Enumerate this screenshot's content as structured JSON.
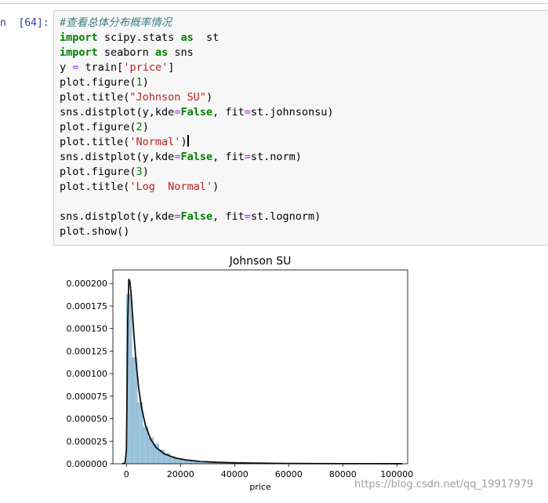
{
  "cell": {
    "prompt": "n  [64]:",
    "code_tokens": [
      [
        [
          "cm",
          "#查看总体分布概率情况"
        ]
      ],
      [
        [
          "kw",
          "import"
        ],
        [
          "t",
          " scipy.stats "
        ],
        [
          "kw",
          "as"
        ],
        [
          "t",
          "  st"
        ]
      ],
      [
        [
          "kw",
          "import"
        ],
        [
          "t",
          " seaborn "
        ],
        [
          "kw",
          "as"
        ],
        [
          "t",
          " sns"
        ]
      ],
      [
        [
          "t",
          "y "
        ],
        [
          "op",
          "="
        ],
        [
          "t",
          " train["
        ],
        [
          "str",
          "'price'"
        ],
        [
          "t",
          "]"
        ]
      ],
      [
        [
          "t",
          "plot.figure("
        ],
        [
          "num",
          "1"
        ],
        [
          "t",
          ")"
        ]
      ],
      [
        [
          "t",
          "plot.title("
        ],
        [
          "str",
          "\"Johnson SU\""
        ],
        [
          "t",
          ")"
        ]
      ],
      [
        [
          "t",
          "sns.distplot(y,kde"
        ],
        [
          "op",
          "="
        ],
        [
          "kw",
          "False"
        ],
        [
          "t",
          ", fit"
        ],
        [
          "op",
          "="
        ],
        [
          "t",
          "st.johnsonsu)"
        ]
      ],
      [
        [
          "t",
          "plot.figure("
        ],
        [
          "num",
          "2"
        ],
        [
          "t",
          ")"
        ]
      ],
      [
        [
          "t",
          "plot.title("
        ],
        [
          "str",
          "'Normal'"
        ],
        [
          "t",
          ")"
        ],
        [
          "cursor",
          ""
        ]
      ],
      [
        [
          "t",
          "sns.distplot(y,kde"
        ],
        [
          "op",
          "="
        ],
        [
          "kw",
          "False"
        ],
        [
          "t",
          ", fit"
        ],
        [
          "op",
          "="
        ],
        [
          "t",
          "st.norm)"
        ]
      ],
      [
        [
          "t",
          "plot.figure("
        ],
        [
          "num",
          "3"
        ],
        [
          "t",
          ")"
        ]
      ],
      [
        [
          "t",
          "plot.title("
        ],
        [
          "str",
          "'Log  Normal'"
        ],
        [
          "t",
          ")"
        ]
      ],
      [],
      [
        [
          "t",
          "sns.distplot(y,kde"
        ],
        [
          "op",
          "="
        ],
        [
          "kw",
          "False"
        ],
        [
          "t",
          ", fit"
        ],
        [
          "op",
          "="
        ],
        [
          "t",
          "st.lognorm)"
        ]
      ],
      [
        [
          "t",
          "plot.show()"
        ]
      ]
    ]
  },
  "chart_data": {
    "type": "bar",
    "title": "Johnson SU",
    "xlabel": "price",
    "ylabel": "",
    "xlim": [
      -5000,
      104000
    ],
    "ylim": [
      0,
      0.000215
    ],
    "grid": false,
    "legend": "none",
    "bin_width": 2000,
    "hist_color": "#9dc4dc",
    "hist_edge": "#6a9fc4",
    "fit_color": "#111111",
    "x_ticks": [
      0,
      20000,
      40000,
      60000,
      80000,
      100000
    ],
    "x_tick_labels": [
      "0",
      "20000",
      "40000",
      "60000",
      "80000",
      "100000"
    ],
    "y_ticks": [
      0,
      2.5e-05,
      5e-05,
      7.5e-05,
      0.0001,
      0.000125,
      0.00015,
      0.000175,
      0.0002
    ],
    "y_tick_labels": [
      "0.000000",
      "0.000025",
      "0.000050",
      "0.000075",
      "0.000100",
      "0.000125",
      "0.000150",
      "0.000175",
      "0.000200"
    ],
    "histogram": {
      "bin_starts": [
        0,
        2000,
        4000,
        6000,
        8000,
        10000,
        12000,
        14000,
        16000,
        18000,
        20000,
        22000,
        24000,
        26000,
        28000,
        30000,
        34000,
        40000,
        50000,
        60000,
        70000,
        80000,
        90000
      ],
      "bin_widths": [
        2000,
        2000,
        2000,
        2000,
        2000,
        2000,
        2000,
        2000,
        2000,
        2000,
        2000,
        2000,
        2000,
        2000,
        2000,
        4000,
        6000,
        10000,
        10000,
        10000,
        10000,
        10000,
        11000
      ],
      "values": [
        0.000188,
        0.000118,
        6.8e-05,
        4.1e-05,
        2.9e-05,
        2.2e-05,
        1.55e-05,
        1.15e-05,
        8e-06,
        6e-06,
        4.5e-06,
        3.5e-06,
        2.8e-06,
        2.2e-06,
        1.7e-06,
        1.3e-06,
        9e-07,
        6e-07,
        3e-07,
        2e-07,
        1e-07,
        1e-07,
        5e-08
      ]
    },
    "fit_curve": {
      "x": [
        -1500,
        -500,
        0,
        200,
        500,
        900,
        1300,
        1700,
        2200,
        2800,
        3500,
        4500,
        5500,
        7000,
        9000,
        11000,
        14000,
        18000,
        22000,
        27000,
        33000,
        40000,
        50000,
        60000,
        70000,
        80000,
        90000,
        102000
      ],
      "y": [
        0,
        1e-06,
        1.5e-05,
        7e-05,
        0.00016,
        0.000205,
        0.000202,
        0.00019,
        0.000168,
        0.000142,
        0.000115,
        8.5e-05,
        6.4e-05,
        4.3e-05,
        2.7e-05,
        1.8e-05,
        1.1e-05,
        6.5e-06,
        4.2e-06,
        2.7e-06,
        1.7e-06,
        1.1e-06,
        6e-07,
        3.5e-07,
        2e-07,
        1.2e-07,
        8e-08,
        5e-08
      ]
    }
  },
  "watermark": "https://blog.csdn.net/qq_19917979"
}
